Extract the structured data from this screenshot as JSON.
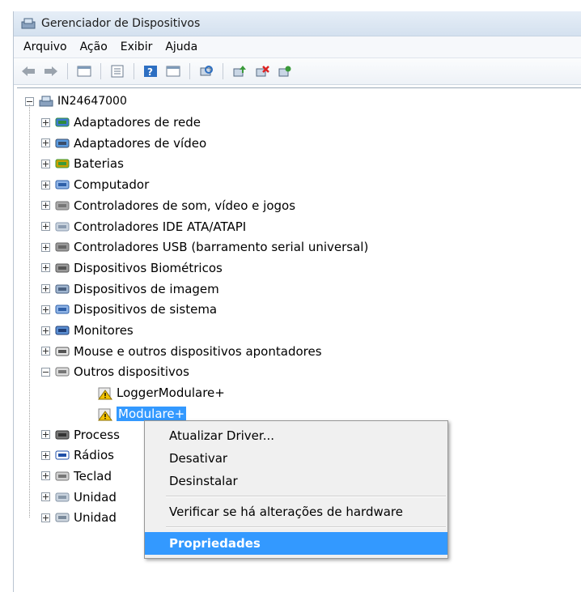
{
  "window": {
    "title": "Gerenciador de Dispositivos"
  },
  "menu": [
    "Arquivo",
    "Ação",
    "Exibir",
    "Ajuda"
  ],
  "toolbar": [
    "back-icon",
    "forward-icon",
    "view-icon",
    "properties-icon",
    "help-icon",
    "view2-icon",
    "scan-icon",
    "update-driver-icon",
    "disable-icon",
    "uninstall-icon"
  ],
  "tree": {
    "root": "IN24647000",
    "categories": [
      {
        "label": "Adaptadores de rede",
        "icon": "network-adapter-icon"
      },
      {
        "label": "Adaptadores de vídeo",
        "icon": "display-adapter-icon"
      },
      {
        "label": "Baterias",
        "icon": "battery-icon"
      },
      {
        "label": "Computador",
        "icon": "computer-icon"
      },
      {
        "label": "Controladores de som, vídeo e jogos",
        "icon": "speaker-icon"
      },
      {
        "label": "Controladores IDE ATA/ATAPI",
        "icon": "ide-controller-icon"
      },
      {
        "label": "Controladores USB (barramento serial universal)",
        "icon": "usb-icon"
      },
      {
        "label": "Dispositivos Biométricos",
        "icon": "biometric-icon"
      },
      {
        "label": "Dispositivos de imagem",
        "icon": "camera-icon"
      },
      {
        "label": "Dispositivos de sistema",
        "icon": "system-device-icon"
      },
      {
        "label": "Monitores",
        "icon": "monitor-icon"
      },
      {
        "label": "Mouse e outros dispositivos apontadores",
        "icon": "mouse-icon"
      },
      {
        "label": "Outros dispositivos",
        "icon": "other-devices-icon"
      }
    ],
    "other_children": [
      "LoggerModulare+",
      "Modulare+"
    ],
    "after": [
      {
        "label": "Process",
        "icon": "processor-icon"
      },
      {
        "label": "Rádios",
        "icon": "bluetooth-icon"
      },
      {
        "label": "Teclad",
        "icon": "keyboard-icon"
      },
      {
        "label": "Unidad",
        "icon": "drive-icon"
      },
      {
        "label": "Unidad",
        "icon": "drive2-icon"
      }
    ]
  },
  "context_menu": {
    "items": [
      "Atualizar Driver...",
      "Desativar",
      "Desinstalar",
      "Verificar se há alterações de hardware",
      "Propriedades"
    ]
  }
}
